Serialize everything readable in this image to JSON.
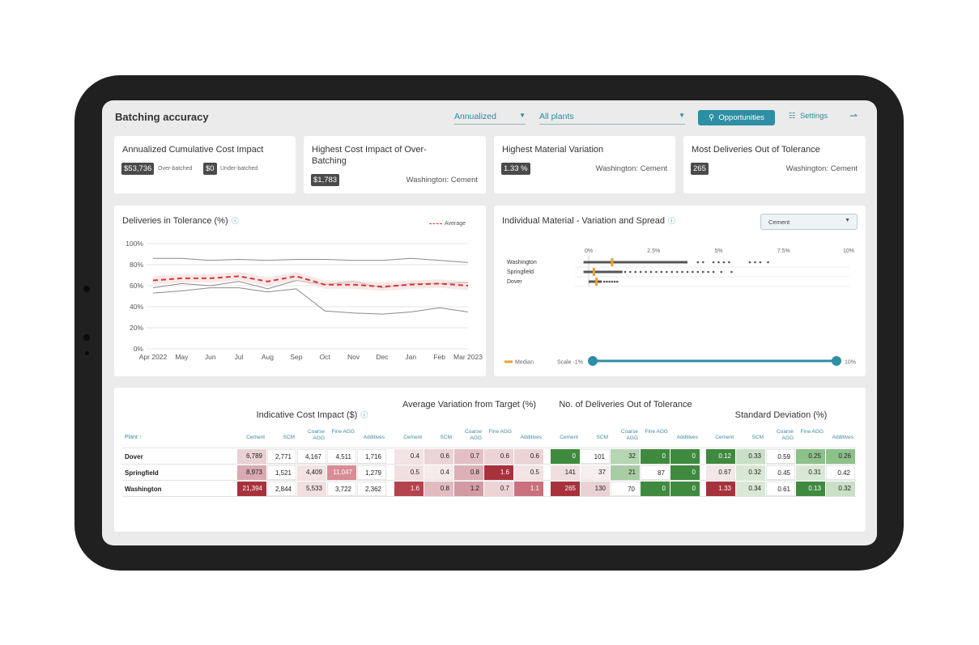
{
  "header": {
    "title": "Batching accuracy",
    "period": "Annualized",
    "plants": "All plants",
    "opportunities_label": "Opportunities",
    "settings_label": "Settings"
  },
  "kpis": [
    {
      "title": "Annualized Cumulative Cost Impact",
      "value1": "$53,736",
      "note1": "Over-batched",
      "value2": "$0",
      "note2": "Under-batched"
    },
    {
      "title": "Highest Cost Impact of Over-Batching",
      "value": "$1,783",
      "detail": "Washington: Cement"
    },
    {
      "title": "Highest Material Variation",
      "value": "1.33 %",
      "detail": "Washington: Cement"
    },
    {
      "title": "Most Deliveries Out of Tolerance",
      "value": "265",
      "detail": "Washington: Cement"
    }
  ],
  "tolerance_chart": {
    "title": "Deliveries in Tolerance (%)",
    "legend": "Average",
    "chart_data": {
      "type": "line",
      "x": [
        "Apr 2022",
        "May",
        "Jun",
        "Jul",
        "Aug",
        "Sep",
        "Oct",
        "Nov",
        "Dec",
        "Jan",
        "Feb",
        "Mar 2023"
      ],
      "y_ticks": [
        "0%",
        "20%",
        "40%",
        "60%",
        "80%",
        "100%"
      ],
      "ylim": [
        0,
        100
      ],
      "series": [
        {
          "values": [
            86,
            86,
            84,
            85,
            84,
            85,
            85,
            84,
            84,
            86,
            84,
            82
          ]
        },
        {
          "values": [
            58,
            62,
            60,
            64,
            57,
            65,
            61,
            64,
            58,
            62,
            62,
            63
          ]
        },
        {
          "values": [
            53,
            55,
            58,
            58,
            54,
            57,
            36,
            34,
            33,
            35,
            39,
            35
          ]
        },
        {
          "name": "Average",
          "values": [
            65,
            67,
            67,
            69,
            64,
            69,
            61,
            61,
            59,
            61,
            62,
            60
          ]
        }
      ]
    }
  },
  "variation_chart": {
    "title": "Individual Material - Variation and Spread",
    "material": "Cement",
    "ticks": [
      "0%",
      "2.5%",
      "5%",
      "7.5%",
      "10%"
    ],
    "tick_values": [
      0,
      2.5,
      5,
      7.5,
      10
    ],
    "plants": [
      {
        "name": "Washington",
        "median": 0.9,
        "min": -0.2,
        "max": 3.8,
        "outliers": [
          4.2,
          4.4,
          4.8,
          5.0,
          5.2,
          5.4,
          6.2,
          6.4,
          6.6,
          6.9
        ]
      },
      {
        "name": "Springfield",
        "median": 0.2,
        "min": -0.2,
        "max": 1.3,
        "outliers": [
          1.4,
          1.6,
          1.8,
          2.0,
          2.2,
          2.4,
          2.6,
          2.8,
          3.0,
          3.2,
          3.4,
          3.6,
          3.8,
          4.0,
          4.2,
          4.4,
          4.6,
          4.8,
          5.1,
          5.5
        ]
      },
      {
        "name": "Dover",
        "median": 0.3,
        "min": 0.0,
        "max": 0.5,
        "outliers": [
          0.6,
          0.7,
          0.8,
          0.9,
          1.0,
          1.1
        ]
      }
    ],
    "median_label": "Median",
    "scale_label": "Scale -1%",
    "scale_max_label": "10%"
  },
  "table": {
    "plant_header": "Plant",
    "groups": [
      {
        "title": "Indicative Cost Impact ($)",
        "info": true
      },
      {
        "title": "Average Variation from Target (%)"
      },
      {
        "title": "No. of Deliveries Out of Tolerance"
      },
      {
        "title": "Standard Deviation (%)"
      }
    ],
    "cols": [
      "Cement",
      "SCM",
      "Coarse AGG",
      "Fine AGG",
      "Additives"
    ],
    "rows": [
      {
        "plant": "Dover",
        "groups": [
          [
            "6,789",
            "2,771",
            "4,167",
            "4,511",
            "1,716"
          ],
          [
            "0.4",
            "0.6",
            "0.7",
            "0.6",
            "0.6"
          ],
          [
            "0",
            "101",
            "32",
            "0",
            "0"
          ],
          [
            "0.12",
            "0.33",
            "0.59",
            "0.25",
            "0.26"
          ]
        ]
      },
      {
        "plant": "Springfield",
        "groups": [
          [
            "8,973",
            "1,521",
            "4,409",
            "11,047",
            "1,279"
          ],
          [
            "0.5",
            "0.4",
            "0.8",
            "1.6",
            "0.5"
          ],
          [
            "141",
            "37",
            "21",
            "87",
            "0"
          ],
          [
            "0.67",
            "0.32",
            "0.45",
            "0.31",
            "0.42"
          ]
        ]
      },
      {
        "plant": "Washington",
        "groups": [
          [
            "21,394",
            "2,844",
            "5,533",
            "3,722",
            "2,362"
          ],
          [
            "1.6",
            "0.8",
            "1.2",
            "0.7",
            "1.1"
          ],
          [
            "265",
            "130",
            "70",
            "0",
            "0"
          ],
          [
            "1.33",
            "0.34",
            "0.61",
            "0.13",
            "0.32"
          ]
        ]
      }
    ],
    "colors": [
      [
        [
          "#ead1d4",
          "#ffffff",
          "#ffffff",
          "#ffffff",
          "#ffffff"
        ],
        [
          "#f3e3e5",
          "#ecd3d6",
          "#e3bfc4",
          "#ecd3d6",
          "#ecd3d6"
        ],
        [
          "#3f8a3f",
          "#ffffff",
          "#b6d5b3",
          "#3f8a3f",
          "#3f8a3f"
        ],
        [
          "#3f8a3f",
          "#c9e0c6",
          "#ffffff",
          "#8ec089",
          "#8ec089"
        ]
      ],
      [
        [
          "#d9aab1",
          "#ffffff",
          "#f3e3e5",
          "#d88c96",
          "#ffffff"
        ],
        [
          "#f1dfe1",
          "#f6eaeb",
          "#dcb0b6",
          "#a8323c",
          "#f3e3e5"
        ],
        [
          "#f0dfe1",
          "#f6eeef",
          "#a8cca4",
          "#ffffff",
          "#3f8a3f"
        ],
        [
          "#f3e7e8",
          "#d8e8d5",
          "#ffffff",
          "#d8e8d5",
          "#ffffff"
        ]
      ],
      [
        [
          "#a8323c",
          "#ffffff",
          "#f1dfe1",
          "#ffffff",
          "#ffffff"
        ],
        [
          "#b5434d",
          "#e2bbc0",
          "#d29aa2",
          "#ecd3d6",
          "#c9727d"
        ],
        [
          "#a8323c",
          "#ead1d4",
          "#ffffff",
          "#3f8a3f",
          "#3f8a3f"
        ],
        [
          "#a8323c",
          "#d8e8d5",
          "#ffffff",
          "#3f8a3f",
          "#c9e0c6"
        ]
      ]
    ]
  }
}
